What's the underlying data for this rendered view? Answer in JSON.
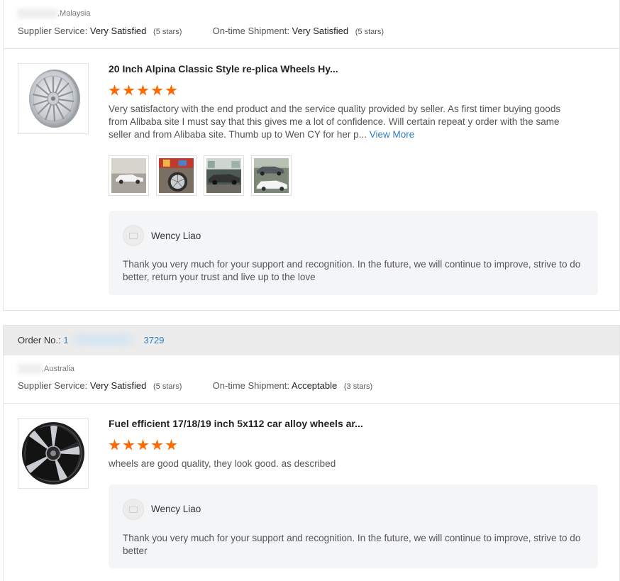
{
  "colors": {
    "star": "#ff6a00",
    "link": "#2f7ec2",
    "reply_bg": "#f4f5f7",
    "order_bar_bg": "#ececec"
  },
  "reviews": [
    {
      "location": ",Malaysia",
      "supplier_service_label": "Supplier Service:",
      "supplier_service_value": "Very Satisfied",
      "supplier_service_stars": "(5 stars)",
      "shipment_label": "On-time Shipment:",
      "shipment_value": "Very Satisfied",
      "shipment_stars": "(5 stars)",
      "product_image_icon": "alloy-wheel-silver",
      "product_title": "20 Inch Alpina Classic Style re-plica Wheels Hy...",
      "rating": 5,
      "review_text": "Very satisfactory with the end product and the service quality provided by seller. As first timer buying goods from Alibaba site I must say that this gives me a lot of confidence. Will certain repeat y order with the same seller and from Alibaba site. Thumb up to Wen CY for her p...",
      "view_more_label": "View More",
      "photos": [
        "car-photo-white-sedan",
        "car-photo-wheel-closeup",
        "car-photo-showroom",
        "car-photo-grey-and-white-sedans"
      ],
      "reply_author": "Wency Liao",
      "reply_text": "Thank you very much for your support and recognition. In the future, we will continue to improve, strive to do better, return your trust and live up to the love"
    },
    {
      "order_label": "Order No.:",
      "order_no_visible_prefix": "1",
      "order_no_visible_suffix": "3729",
      "location": ",Australia",
      "supplier_service_label": "Supplier Service:",
      "supplier_service_value": "Very Satisfied",
      "supplier_service_stars": "(5 stars)",
      "shipment_label": "On-time Shipment:",
      "shipment_value": "Acceptable",
      "shipment_stars": "(3 stars)",
      "product_image_icon": "alloy-wheel-black-machined",
      "product_title": "Fuel efficient 17/18/19 inch 5x112 car alloy wheels ar...",
      "rating": 5,
      "review_text": "wheels are good quality, they look good. as described",
      "reply_author": "Wency Liao",
      "reply_text": "Thank you very much for your support and recognition. In the future, we will continue to improve, strive to do better"
    }
  ]
}
